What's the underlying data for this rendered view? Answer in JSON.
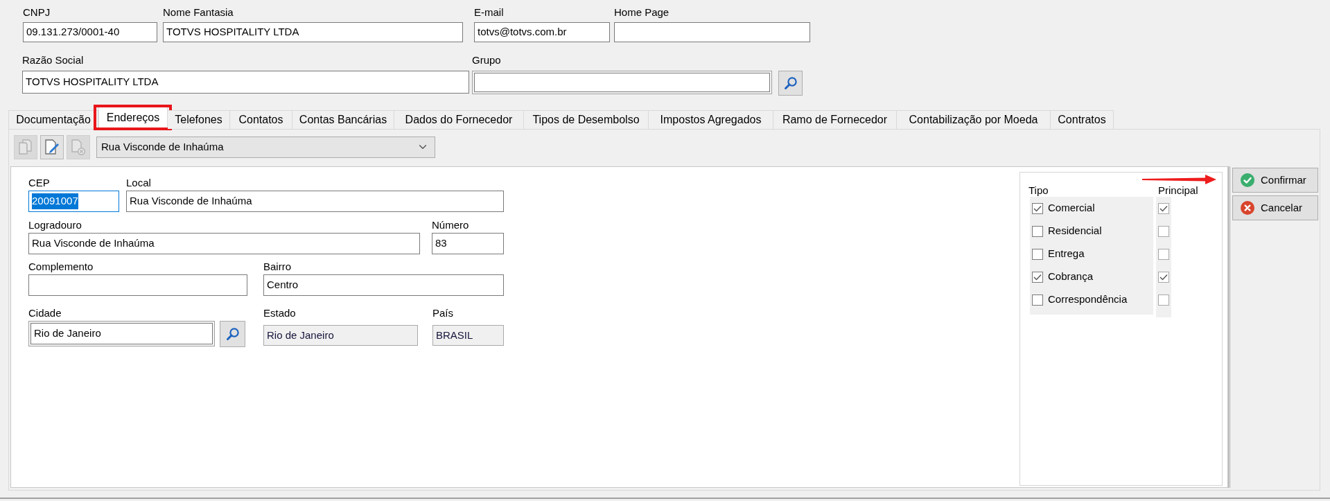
{
  "header": {
    "rows": [
      {
        "fields": [
          {
            "kind": "text",
            "label": "CNPJ",
            "value": "09.131.273/0001-40"
          },
          {
            "kind": "text",
            "label": "Nome Fantasia",
            "value": "TOTVS HOSPITALITY LTDA"
          },
          {
            "kind": "text",
            "label": "E-mail",
            "value": "totvs@totvs.com.br"
          },
          {
            "kind": "text",
            "label": "Home Page"
          }
        ]
      },
      {
        "fields": [
          {
            "kind": "text",
            "label": "Razão Social",
            "value": "TOTVS HOSPITALITY LTDA"
          },
          {
            "kind": "lookup",
            "label": "Grupo"
          }
        ]
      }
    ]
  },
  "tabs": [
    {
      "label": "Documentação",
      "selected": false,
      "highlighted": false
    },
    {
      "label": "Endereços",
      "selected": true,
      "highlighted": true
    },
    {
      "label": "Telefones",
      "selected": false,
      "highlighted": false
    },
    {
      "label": "Contatos",
      "selected": false,
      "highlighted": false
    },
    {
      "label": "Contas Bancárias",
      "selected": false,
      "highlighted": false
    },
    {
      "label": "Dados do Fornecedor",
      "selected": false,
      "highlighted": false
    },
    {
      "label": "Tipos de Desembolso",
      "selected": false,
      "highlighted": false
    },
    {
      "label": "Impostos Agregados",
      "selected": false,
      "highlighted": false
    },
    {
      "label": "Ramo de Fornecedor",
      "selected": false,
      "highlighted": false
    },
    {
      "label": "Contabilização por Moeda",
      "selected": false,
      "highlighted": false
    },
    {
      "label": "Contratos",
      "selected": false,
      "highlighted": false
    }
  ],
  "toolbar": {
    "buttons": [
      {
        "kind": "add",
        "disabled": true
      },
      {
        "kind": "edit",
        "disabled": false
      },
      {
        "kind": "remove",
        "disabled": true
      }
    ],
    "address_select": {
      "value": "Rua Visconde de Inhaúma"
    }
  },
  "address": {
    "rows": [
      {
        "fields": [
          {
            "kind": "text",
            "label": "CEP",
            "value": "20091007",
            "focused": true
          },
          {
            "kind": "text",
            "label": "Local",
            "value": "Rua Visconde de Inhaúma",
            "focused": false
          }
        ]
      },
      {
        "fields": [
          {
            "kind": "text",
            "label": "Logradouro",
            "value": "Rua Visconde de Inhaúma",
            "focused": false
          },
          {
            "kind": "text",
            "label": "Número",
            "value": "83",
            "focused": false
          }
        ]
      },
      {
        "fields": [
          {
            "kind": "text",
            "label": "Complemento",
            "focused": false
          },
          {
            "kind": "text",
            "label": "Bairro",
            "value": "Centro",
            "focused": false
          }
        ]
      },
      {
        "fields": [
          {
            "kind": "lookup",
            "label": "Cidade",
            "value": "Rio de Janeiro",
            "focused": false
          },
          {
            "kind": "readonly",
            "label": "Estado",
            "value": "Rio de Janeiro",
            "focused": false
          },
          {
            "kind": "readonly",
            "label": "País",
            "value": "BRASIL",
            "focused": false
          }
        ]
      }
    ]
  },
  "types": {
    "heading": "Tipo",
    "principal_heading": "Principal",
    "items": [
      {
        "label": "Comercial",
        "checked": true,
        "principal": true
      },
      {
        "label": "Residencial",
        "checked": false,
        "principal": false
      },
      {
        "label": "Entrega",
        "checked": false,
        "principal": false
      },
      {
        "label": "Cobrança",
        "checked": true,
        "principal": true
      },
      {
        "label": "Correspondência",
        "checked": false,
        "principal": false
      }
    ]
  },
  "actions": [
    {
      "kind": "confirm",
      "label": "Confirmar"
    },
    {
      "kind": "cancel",
      "label": "Cancelar"
    }
  ]
}
